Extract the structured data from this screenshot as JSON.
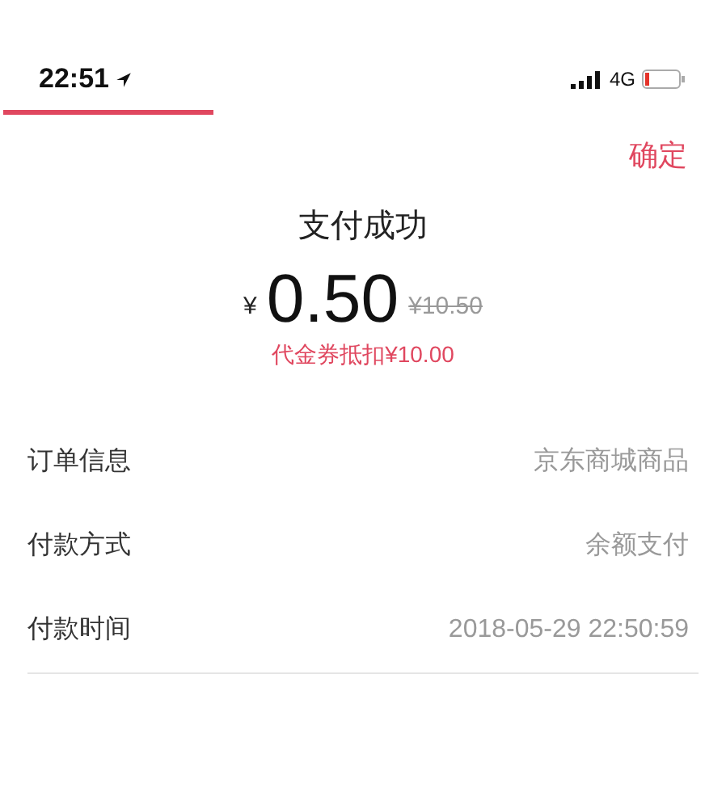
{
  "status_bar": {
    "time": "22:51",
    "network": "4G"
  },
  "confirm_button": "确定",
  "result": {
    "title": "支付成功",
    "currency": "¥",
    "amount": "0.50",
    "original_price": "¥10.50",
    "discount_note": "代金券抵扣¥10.00"
  },
  "details": [
    {
      "label": "订单信息",
      "value": "京东商城商品"
    },
    {
      "label": "付款方式",
      "value": "余额支付"
    },
    {
      "label": "付款时间",
      "value": "2018-05-29 22:50:59"
    }
  ]
}
